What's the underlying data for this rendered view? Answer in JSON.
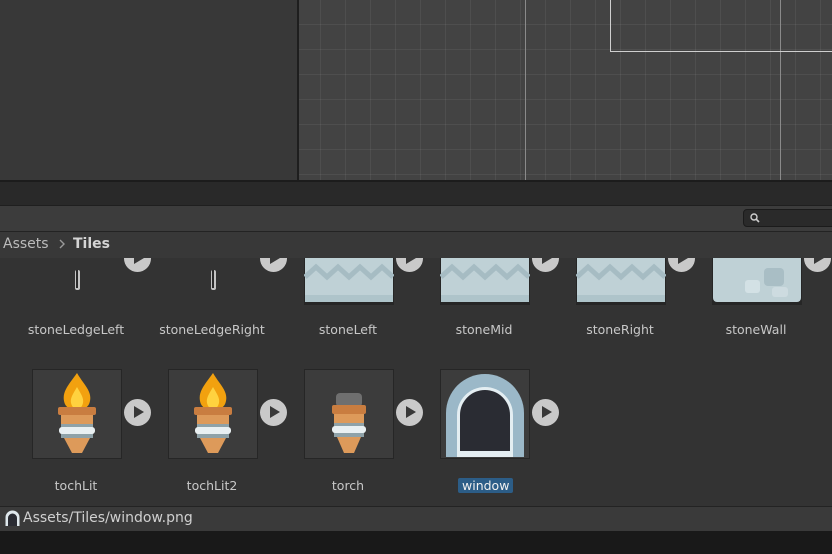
{
  "search": {
    "placeholder": ""
  },
  "breadcrumb": {
    "root": "Assets",
    "current": "Tiles"
  },
  "assets": {
    "row1": [
      {
        "label": "stoneLedgeLeft"
      },
      {
        "label": "stoneLedgeRight"
      },
      {
        "label": "stoneLeft"
      },
      {
        "label": "stoneMid"
      },
      {
        "label": "stoneRight"
      },
      {
        "label": "stoneWall"
      }
    ],
    "row2": [
      {
        "label": "tochLit"
      },
      {
        "label": "tochLit2"
      },
      {
        "label": "torch"
      },
      {
        "label": "window",
        "selected": true
      }
    ]
  },
  "status": {
    "path": "Assets/Tiles/window.png"
  },
  "colors": {
    "selection": "#2c5d87",
    "tile_stone": "#bfd1d6",
    "tile_window": "#9bb8c8",
    "flame": "#f2a10f"
  }
}
